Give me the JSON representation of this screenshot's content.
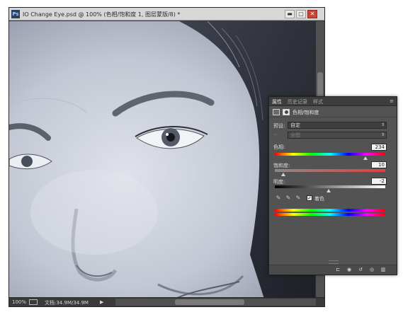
{
  "document": {
    "app_badge": "Ps",
    "title": "IO Change Eye.psd @ 100% (色相/饱和度 1, 图层蒙版/8) *",
    "controls": {
      "minimize": "▬",
      "maximize": "▢",
      "close": "✕"
    }
  },
  "statusbar": {
    "zoom": "100%",
    "doc_info": "文档:34.9M/34.9M",
    "arrow": "▶"
  },
  "panel": {
    "tabs": [
      {
        "label": "属性"
      },
      {
        "label": "历史记录"
      },
      {
        "label": "样式"
      }
    ],
    "menu_icon": "≡",
    "header_title": "色相/饱和度",
    "preset": {
      "label": "预设:",
      "value": "自定"
    },
    "channel": {
      "value": "全图"
    },
    "hue": {
      "label": "色相:",
      "value": "234",
      "slider_fraction": 0.82
    },
    "saturation": {
      "label": "饱和度:",
      "value": "10",
      "slider_fraction": 0.08
    },
    "lightness": {
      "label": "明度:",
      "value": "-2",
      "slider_fraction": 0.49
    },
    "colorize": {
      "label": "着色",
      "checked": true
    },
    "footer_icons": [
      "clip-icon",
      "eye-preview-icon",
      "reset-icon",
      "visibility-icon",
      "trash-icon"
    ]
  },
  "colors": {
    "hue_gradient": "linear-gradient(to right,#ff0000,#ffff00,#00ff00,#00ffff,#0000ff,#ff00ff,#ff0000)",
    "sat_gradient": "linear-gradient(to right,#8a8a8a,#e23e3e)",
    "light_gradient": "linear-gradient(to right,#000000,#8a8a8a,#ffffff)",
    "colorize_tint": "#5a6690"
  }
}
